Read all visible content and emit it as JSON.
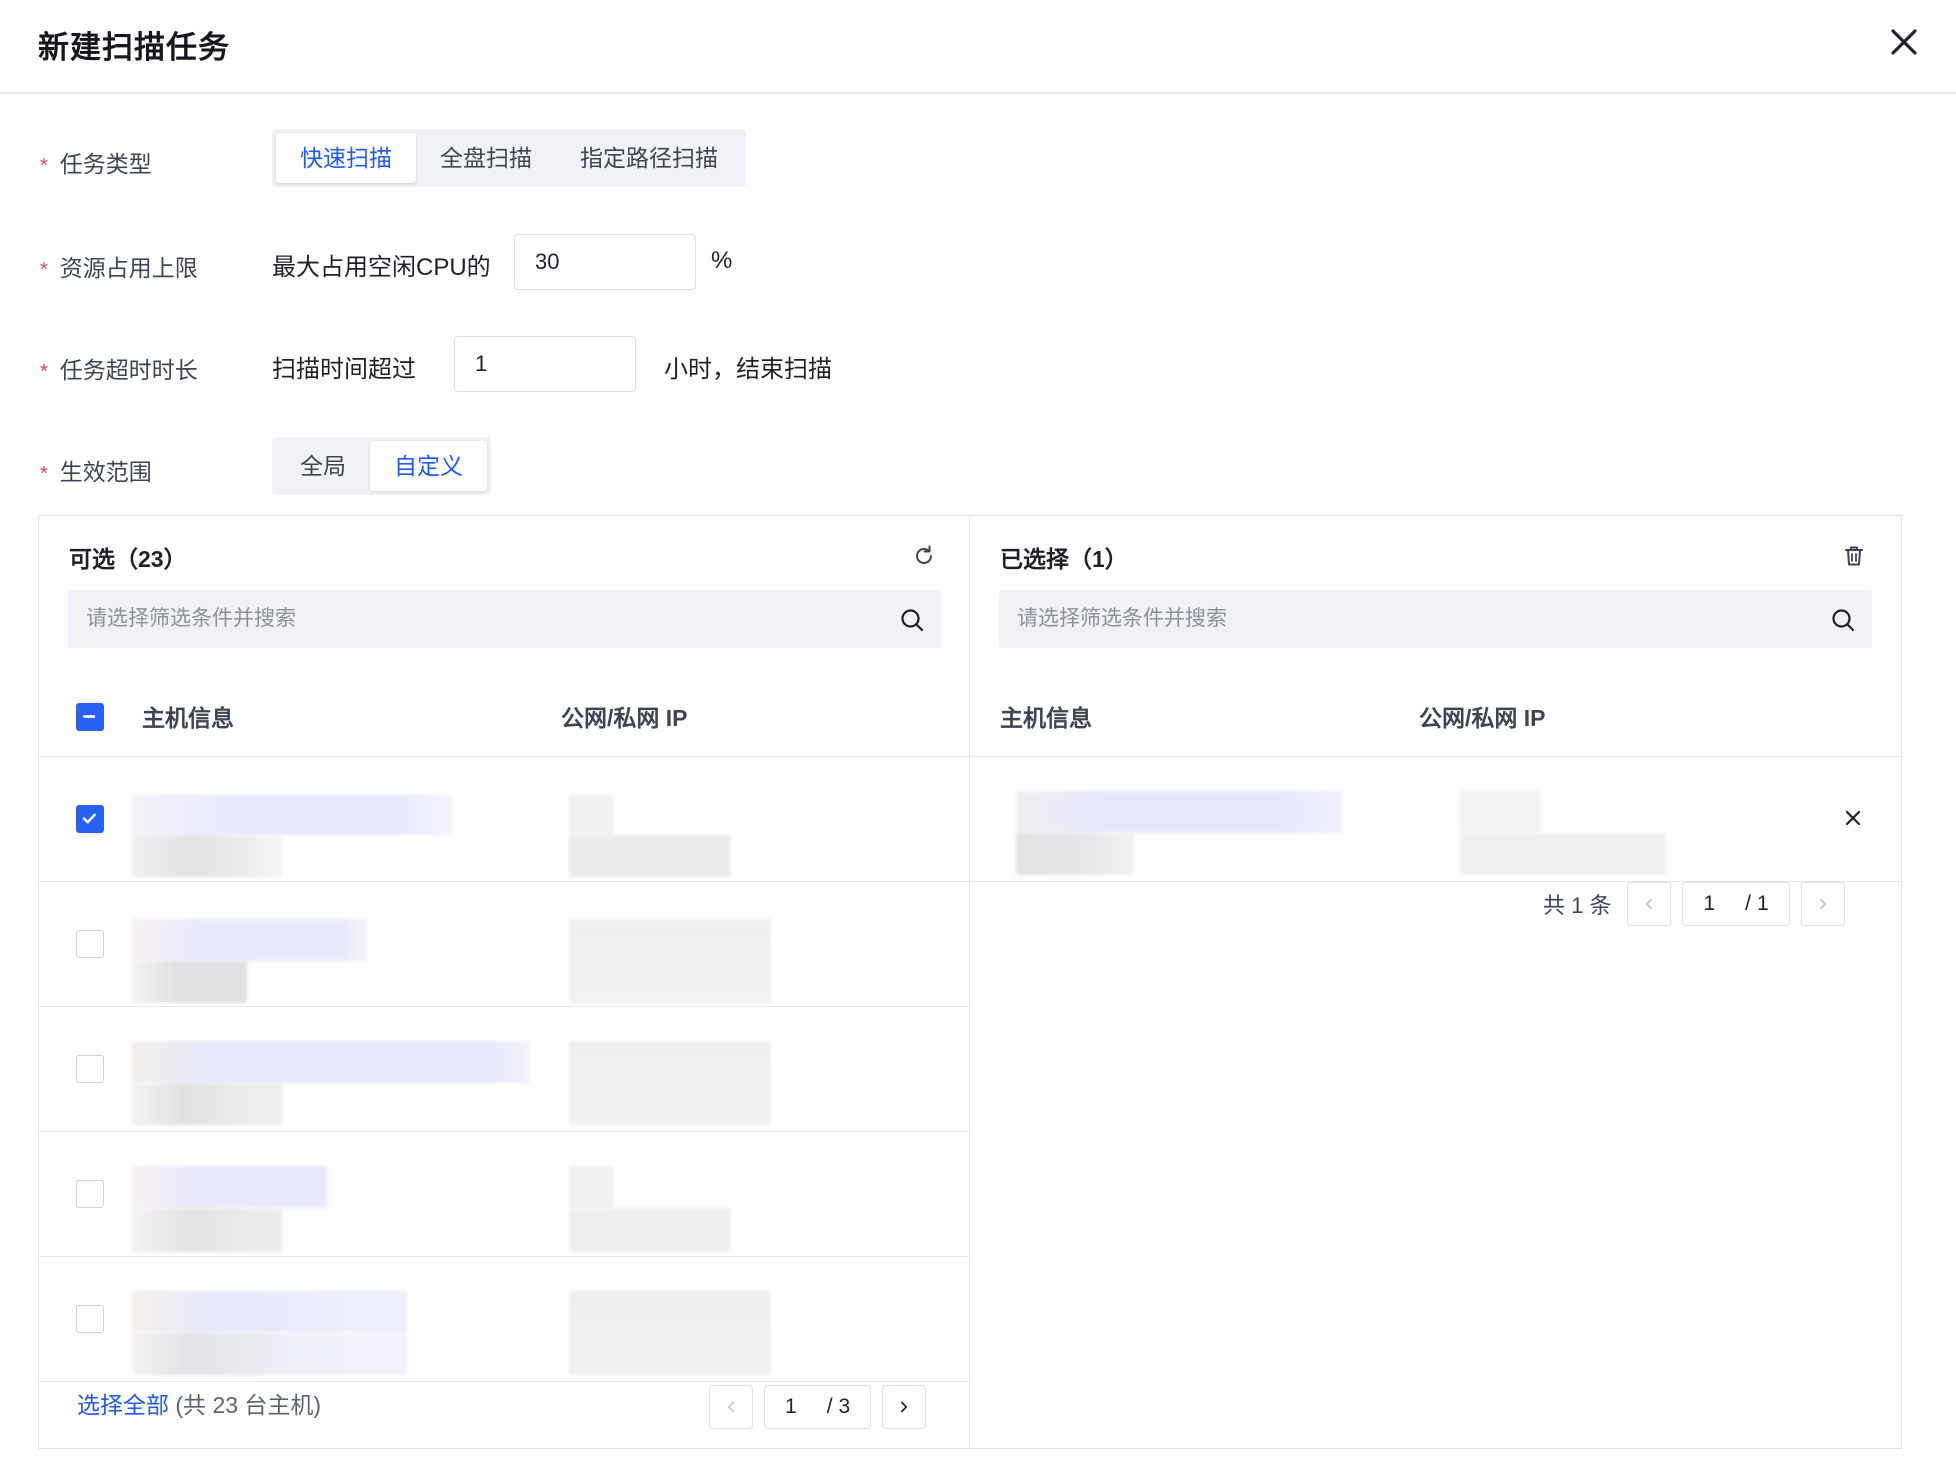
{
  "dialog": {
    "title": "新建扫描任务"
  },
  "form": {
    "task_type": {
      "label": "任务类型",
      "options": [
        "快速扫描",
        "全盘扫描",
        "指定路径扫描"
      ],
      "selected": "快速扫描"
    },
    "resource_limit": {
      "label": "资源占用上限",
      "prefix": "最大占用空闲CPU的",
      "value": "30",
      "suffix": "%"
    },
    "timeout": {
      "label": "任务超时时长",
      "prefix": "扫描时间超过",
      "value": "1",
      "suffix": "小时，结束扫描"
    },
    "scope": {
      "label": "生效范围",
      "options": [
        "全局",
        "自定义"
      ],
      "selected": "自定义"
    }
  },
  "transfer": {
    "left": {
      "title": "可选（23）",
      "search_placeholder": "请选择筛选条件并搜索",
      "columns": [
        "主机信息",
        "公网/私网 IP"
      ],
      "header_checkbox": "partial",
      "rows": [
        {
          "checked": true
        },
        {
          "checked": false
        },
        {
          "checked": false
        },
        {
          "checked": false
        },
        {
          "checked": false
        }
      ],
      "select_all_label": "选择全部",
      "total_note": "(共 23 台主机)",
      "pagination": {
        "current": "1",
        "total": "3"
      }
    },
    "right": {
      "title": "已选择（1）",
      "search_placeholder": "请选择筛选条件并搜索",
      "columns": [
        "主机信息",
        "公网/私网 IP"
      ],
      "total_text": "共 1 条",
      "pagination": {
        "current": "1",
        "total": "1"
      }
    }
  },
  "colors": {
    "primary": "#1e5af5",
    "required": "#e54545",
    "checkbox": "#2962f3"
  },
  "icons": {
    "close": "close-icon",
    "refresh": "refresh-icon",
    "trash": "trash-icon",
    "search": "search-icon",
    "remove": "remove-icon",
    "prev": "chevron-left-icon",
    "next": "chevron-right-icon"
  }
}
